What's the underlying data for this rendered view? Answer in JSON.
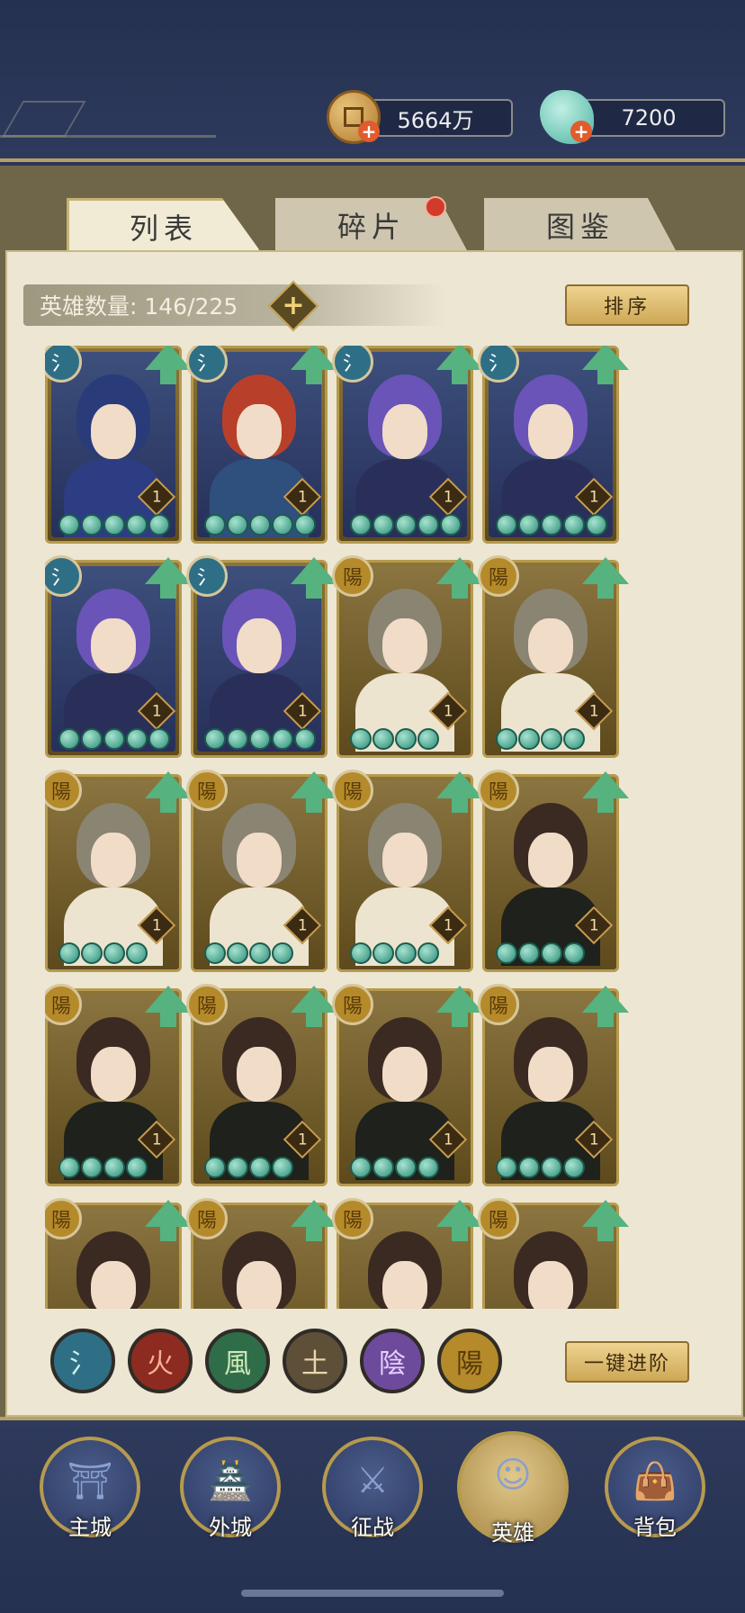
{
  "currencies": {
    "coins": "5664万",
    "jade": "7200"
  },
  "tabs": [
    {
      "label": "列表",
      "active": true
    },
    {
      "label": "碎片",
      "active": false,
      "has_notification": true
    },
    {
      "label": "图鉴",
      "active": false
    }
  ],
  "hero_count": {
    "label": "英雄数量: 146/225",
    "add_symbol": "+"
  },
  "sort_button": "排序",
  "advance_button": "一键进阶",
  "heroes": [
    {
      "element": "氵",
      "element_type": "water",
      "level": "1",
      "stars": 5,
      "hair": "#2a3b7a",
      "body": "#2c3d84"
    },
    {
      "element": "氵",
      "element_type": "water",
      "level": "1",
      "stars": 5,
      "hair": "#b8402a",
      "body": "#2f4f7c"
    },
    {
      "element": "氵",
      "element_type": "water",
      "level": "1",
      "stars": 5,
      "hair": "#6a54b8",
      "body": "#2a2f5a"
    },
    {
      "element": "氵",
      "element_type": "water",
      "level": "1",
      "stars": 5,
      "hair": "#6a54b8",
      "body": "#2a2f5a"
    },
    {
      "element": "氵",
      "element_type": "water",
      "level": "1",
      "stars": 5,
      "hair": "#6a54b8",
      "body": "#2a2f5a"
    },
    {
      "element": "氵",
      "element_type": "water",
      "level": "1",
      "stars": 5,
      "hair": "#6a54b8",
      "body": "#2a2f5a"
    },
    {
      "element": "陽",
      "element_type": "yang",
      "level": "1",
      "stars": 4,
      "hair": "#8a8472",
      "body": "#ece4cf"
    },
    {
      "element": "陽",
      "element_type": "yang",
      "level": "1",
      "stars": 4,
      "hair": "#8a8472",
      "body": "#ece4cf"
    },
    {
      "element": "陽",
      "element_type": "yang",
      "level": "1",
      "stars": 4,
      "hair": "#8a8472",
      "body": "#ece4cf"
    },
    {
      "element": "陽",
      "element_type": "yang",
      "level": "1",
      "stars": 4,
      "hair": "#8a8472",
      "body": "#ece4cf"
    },
    {
      "element": "陽",
      "element_type": "yang",
      "level": "1",
      "stars": 4,
      "hair": "#8a8472",
      "body": "#ece4cf"
    },
    {
      "element": "陽",
      "element_type": "yang",
      "level": "1",
      "stars": 4,
      "hair": "#3b2a22",
      "body": "#1e211c"
    },
    {
      "element": "陽",
      "element_type": "yang",
      "level": "1",
      "stars": 4,
      "hair": "#3b2a22",
      "body": "#1e211c"
    },
    {
      "element": "陽",
      "element_type": "yang",
      "level": "1",
      "stars": 4,
      "hair": "#3b2a22",
      "body": "#1e211c"
    },
    {
      "element": "陽",
      "element_type": "yang",
      "level": "1",
      "stars": 4,
      "hair": "#3b2a22",
      "body": "#1e211c"
    },
    {
      "element": "陽",
      "element_type": "yang",
      "level": "1",
      "stars": 4,
      "hair": "#3b2a22",
      "body": "#1e211c"
    },
    {
      "element": "陽",
      "element_type": "yang",
      "level": "",
      "stars": 0,
      "hair": "#3b2a22",
      "body": "#1e211c"
    },
    {
      "element": "陽",
      "element_type": "yang",
      "level": "",
      "stars": 0,
      "hair": "#3b2a22",
      "body": "#1e211c"
    },
    {
      "element": "陽",
      "element_type": "yang",
      "level": "",
      "stars": 0,
      "hair": "#3b2a22",
      "body": "#1e211c"
    },
    {
      "element": "陽",
      "element_type": "yang",
      "level": "",
      "stars": 0,
      "hair": "#3b2a22",
      "body": "#1e211c"
    }
  ],
  "element_filters": [
    {
      "glyph": "氵",
      "type": "water"
    },
    {
      "glyph": "火",
      "type": "fire"
    },
    {
      "glyph": "風",
      "type": "wind"
    },
    {
      "glyph": "土",
      "type": "earth"
    },
    {
      "glyph": "陰",
      "type": "yin"
    },
    {
      "glyph": "陽",
      "type": "yang"
    }
  ],
  "nav": [
    {
      "label": "主城",
      "icon": "palace-icon",
      "active": false
    },
    {
      "label": "外城",
      "icon": "city-gate-icon",
      "active": false
    },
    {
      "label": "征战",
      "icon": "battle-icon",
      "active": false
    },
    {
      "label": "英雄",
      "icon": "hero-portrait-icon",
      "active": true
    },
    {
      "label": "背包",
      "icon": "bag-icon",
      "active": false
    }
  ]
}
